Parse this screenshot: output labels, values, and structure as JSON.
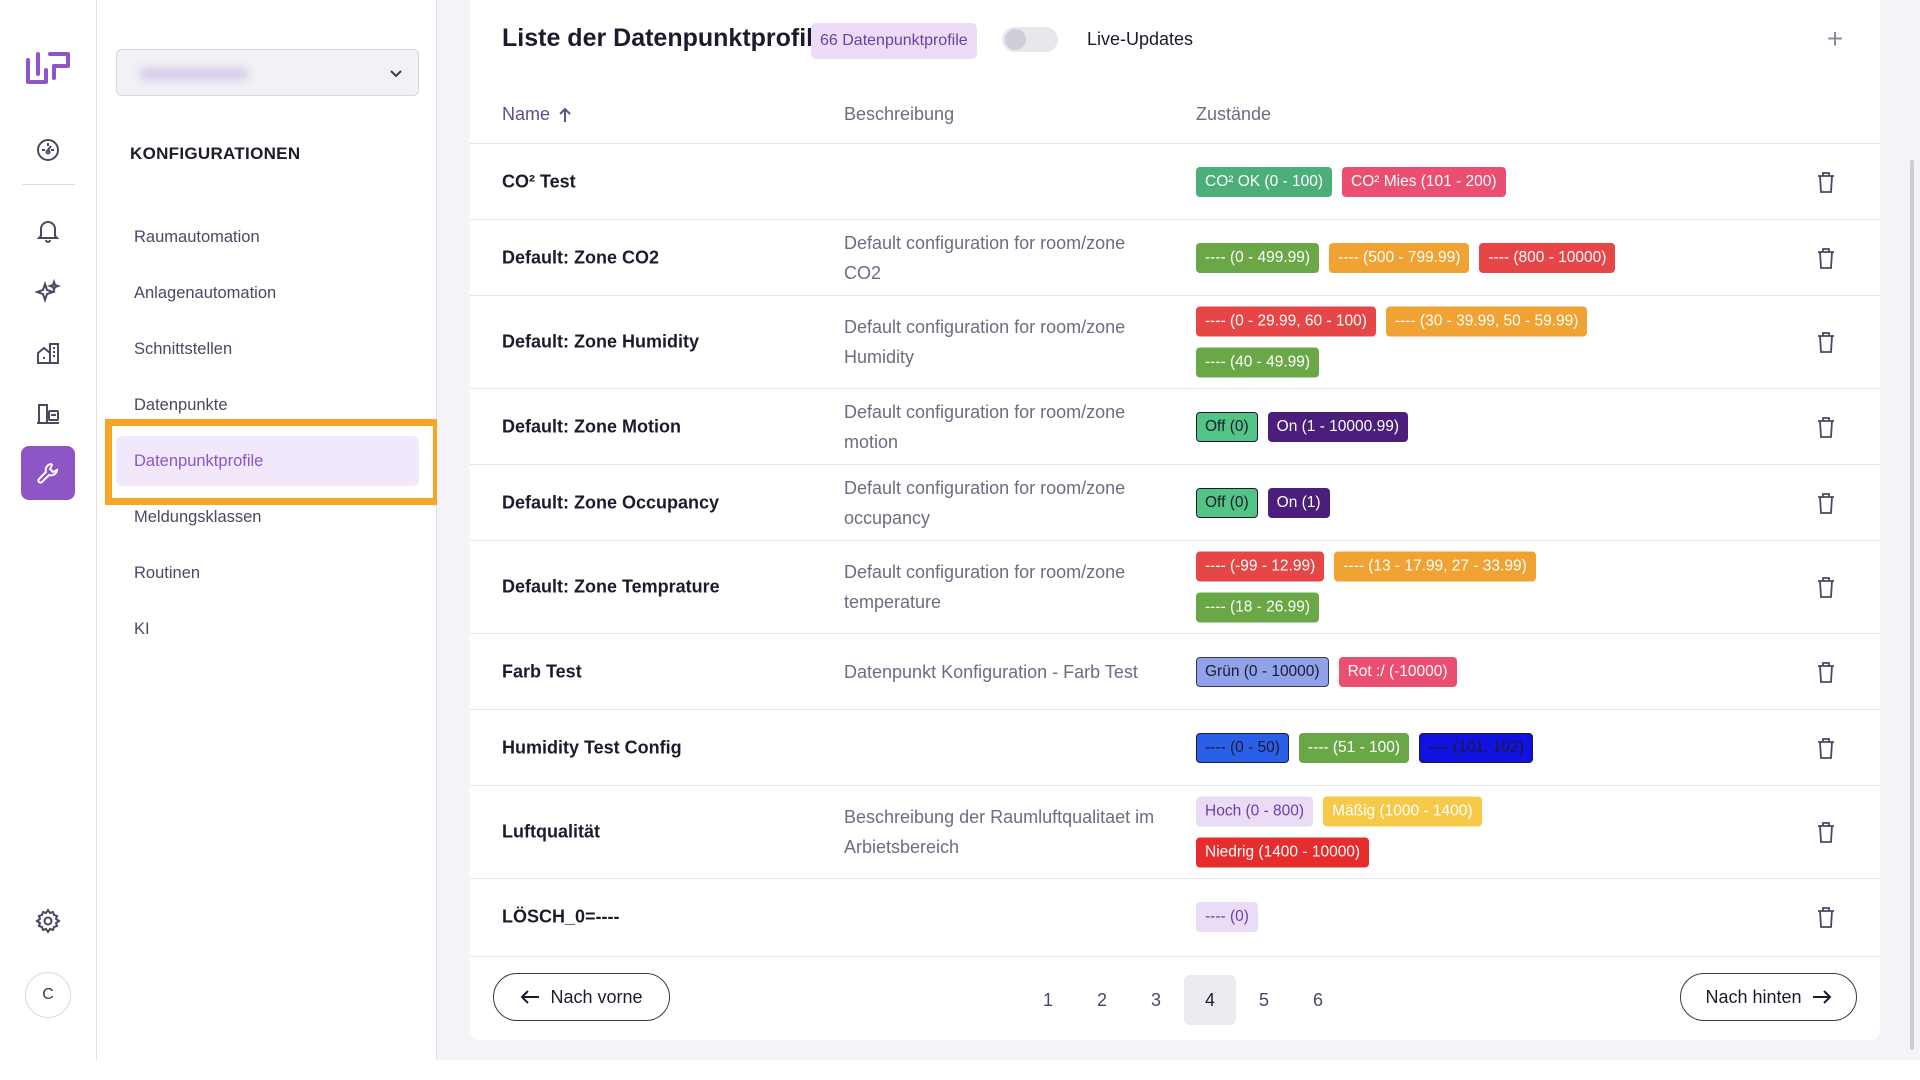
{
  "rail": {
    "avatar": "C",
    "icons": [
      "logo-icon",
      "dashboard-icon",
      "bell-icon",
      "sparkle-icon",
      "buildings-icon",
      "assets-icon",
      "wrench-icon",
      "settings-icon"
    ]
  },
  "subnav": {
    "section_title": "KONFIGURATIONEN",
    "items": [
      {
        "label": "Raumautomation"
      },
      {
        "label": "Anlagenautomation"
      },
      {
        "label": "Schnittstellen"
      },
      {
        "label": "Datenpunkte"
      },
      {
        "label": "Datenpunktprofile"
      },
      {
        "label": "Meldungsklassen"
      },
      {
        "label": "Routinen"
      },
      {
        "label": "KI"
      }
    ],
    "active_index": 4
  },
  "header": {
    "title": "Liste der Datenpunktprofile",
    "count_badge": "66 Datenpunktprofile",
    "live_label": "Live-Updates",
    "live_on": false,
    "add_label": "+"
  },
  "columns": {
    "name": "Name",
    "description": "Beschreibung",
    "states": "Zustände"
  },
  "colors": {
    "accent": "#8d55c6",
    "highlight": "#f6a623"
  },
  "rows": [
    {
      "name": "CO² Test",
      "description": "",
      "height": 0,
      "states": [
        {
          "label": "CO² OK (0 - 100)",
          "bg": "#4caf7a",
          "fg": "#ffffff"
        },
        {
          "label": "CO² Mies (101 - 200)",
          "bg": "#ea4f72",
          "fg": "#ffffff"
        }
      ]
    },
    {
      "name": "Default: Zone CO2",
      "description": "Default configuration for room/zone CO2",
      "states": [
        {
          "label": "---- (0 - 499.99)",
          "bg": "#6aa746",
          "fg": "#ffffff"
        },
        {
          "label": "---- (500 - 799.99)",
          "bg": "#f0a232",
          "fg": "#ffffff"
        },
        {
          "label": "---- (800 - 10000)",
          "bg": "#e64646",
          "fg": "#ffffff"
        }
      ]
    },
    {
      "name": "Default: Zone Humidity",
      "description": "Default configuration for room/zone Humidity",
      "states": [
        {
          "label": "---- (0 - 29.99, 60 - 100)",
          "bg": "#e64646",
          "fg": "#ffffff"
        },
        {
          "label": "---- (30 - 39.99, 50 - 59.99)",
          "bg": "#f0a232",
          "fg": "#ffffff"
        },
        {
          "label": "---- (40 - 49.99)",
          "bg": "#6aa746",
          "fg": "#ffffff"
        }
      ]
    },
    {
      "name": "Default: Zone Motion",
      "description": "Default configuration for room/zone motion",
      "states": [
        {
          "label": "Off (0)",
          "bg": "#52c485",
          "fg": "#1c1b2e",
          "border": "#1c1b2e"
        },
        {
          "label": "On (1 - 10000.99)",
          "bg": "#4a1e7a",
          "fg": "#ffffff"
        }
      ]
    },
    {
      "name": "Default: Zone Occupancy",
      "description": "Default configuration for room/zone occupancy",
      "states": [
        {
          "label": "Off (0)",
          "bg": "#52c485",
          "fg": "#1c1b2e",
          "border": "#1c1b2e"
        },
        {
          "label": "On (1)",
          "bg": "#4a1e7a",
          "fg": "#ffffff"
        }
      ]
    },
    {
      "name": "Default: Zone Temprature",
      "description": "Default configuration for room/zone temperature",
      "states": [
        {
          "label": "---- (-99 - 12.99)",
          "bg": "#e64646",
          "fg": "#ffffff"
        },
        {
          "label": "---- (13 - 17.99, 27 - 33.99)",
          "bg": "#f0a232",
          "fg": "#ffffff"
        },
        {
          "label": "---- (18 - 26.99)",
          "bg": "#6aa746",
          "fg": "#ffffff"
        }
      ]
    },
    {
      "name": "Farb Test",
      "description": "Datenpunkt Konfiguration - Farb Test",
      "states": [
        {
          "label": "Grün (0 - 10000)",
          "bg": "#8fa2ea",
          "fg": "#1c1b2e",
          "border": "#3a374f"
        },
        {
          "label": "Rot :/ (-10000)",
          "bg": "#ea4f72",
          "fg": "#ffffff"
        }
      ]
    },
    {
      "name": "Humidity Test Config",
      "description": "",
      "states": [
        {
          "label": "---- (0 - 50)",
          "bg": "#2a5fe8",
          "fg": "#1c1b2e",
          "border": "#1c1b2e"
        },
        {
          "label": "---- (51 - 100)",
          "bg": "#6aa746",
          "fg": "#ffffff"
        },
        {
          "label": "---- (101, 102)",
          "bg": "#1212e0",
          "fg": "#1c1b2e",
          "border": "#1c1b2e"
        }
      ]
    },
    {
      "name": "Luftqualität",
      "description": "Beschreibung der Raumluftqualitaet im Arbietsbereich",
      "states": [
        {
          "label": "Hoch (0 - 800)",
          "bg": "#eadcf5",
          "fg": "#6b3fa5"
        },
        {
          "label": "Mäßig (1000 - 1400)",
          "bg": "#f7c948",
          "fg": "#ffffff"
        },
        {
          "label": "Niedrig (1400 - 10000)",
          "bg": "#e62c2c",
          "fg": "#ffffff"
        }
      ]
    },
    {
      "name": "LÖSCH_0=----",
      "description": "",
      "states": [
        {
          "label": "---- (0)",
          "bg": "#eadcf5",
          "fg": "#6b3fa5"
        }
      ]
    }
  ],
  "pagination": {
    "prev_label": "Nach vorne",
    "next_label": "Nach hinten",
    "pages": [
      "1",
      "2",
      "3",
      "4",
      "5",
      "6"
    ],
    "current": "4"
  }
}
